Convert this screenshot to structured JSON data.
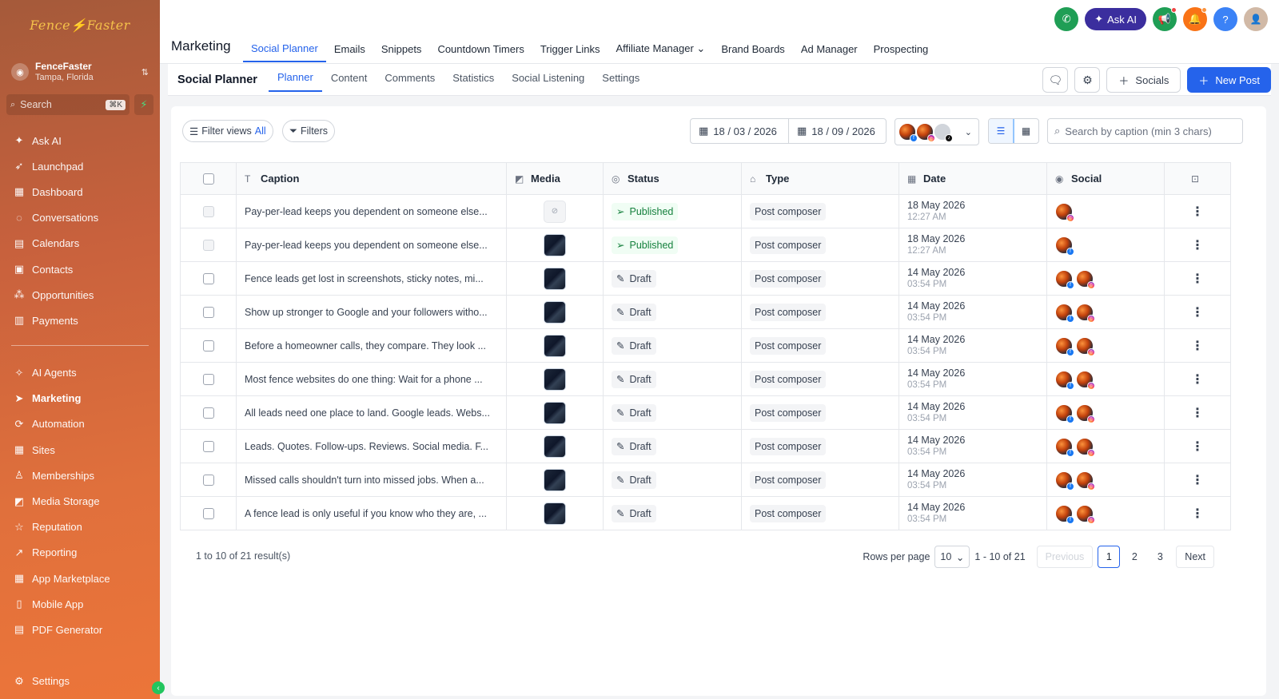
{
  "sidebar": {
    "logo_text": "Fence⚡Faster",
    "account_name": "FenceFaster",
    "account_location": "Tampa, Florida",
    "search_placeholder": "Search",
    "search_shortcut": "⌘K",
    "items_top": [
      {
        "label": "Ask AI",
        "icon": "sparkle-icon"
      },
      {
        "label": "Launchpad",
        "icon": "rocket-icon"
      },
      {
        "label": "Dashboard",
        "icon": "dashboard-icon"
      },
      {
        "label": "Conversations",
        "icon": "chat-icon"
      },
      {
        "label": "Calendars",
        "icon": "calendar-icon"
      },
      {
        "label": "Contacts",
        "icon": "contacts-icon"
      },
      {
        "label": "Opportunities",
        "icon": "opportunities-icon"
      },
      {
        "label": "Payments",
        "icon": "payments-icon"
      }
    ],
    "items_bottom": [
      {
        "label": "AI Agents",
        "icon": "ai-agents-icon"
      },
      {
        "label": "Marketing",
        "icon": "send-icon"
      },
      {
        "label": "Automation",
        "icon": "automation-icon"
      },
      {
        "label": "Sites",
        "icon": "sites-icon"
      },
      {
        "label": "Memberships",
        "icon": "memberships-icon"
      },
      {
        "label": "Media Storage",
        "icon": "media-icon"
      },
      {
        "label": "Reputation",
        "icon": "star-icon"
      },
      {
        "label": "Reporting",
        "icon": "chart-icon"
      },
      {
        "label": "App Marketplace",
        "icon": "apps-icon"
      },
      {
        "label": "Mobile App",
        "icon": "mobile-icon"
      },
      {
        "label": "PDF Generator",
        "icon": "pdf-icon"
      }
    ],
    "settings_label": "Settings"
  },
  "header": {
    "ask_ai_label": "Ask AI",
    "module_title": "Marketing",
    "tabs": [
      {
        "label": "Social Planner",
        "active": true
      },
      {
        "label": "Emails"
      },
      {
        "label": "Snippets"
      },
      {
        "label": "Countdown Timers"
      },
      {
        "label": "Trigger Links"
      },
      {
        "label": "Affiliate Manager ⌄"
      },
      {
        "label": "Brand Boards"
      },
      {
        "label": "Ad Manager"
      },
      {
        "label": "Prospecting"
      }
    ]
  },
  "subheader": {
    "title": "Social Planner",
    "tabs": [
      {
        "label": "Planner",
        "active": true
      },
      {
        "label": "Content"
      },
      {
        "label": "Comments"
      },
      {
        "label": "Statistics"
      },
      {
        "label": "Social Listening"
      },
      {
        "label": "Settings"
      }
    ],
    "socials_label": "Socials",
    "new_post_label": "New Post"
  },
  "toolbar": {
    "filter_views_label": "Filter views",
    "filter_views_value": "All",
    "filters_label": "Filters",
    "date_from": "18 / 03 / 2026",
    "date_to": "18 / 09 / 2026",
    "search_placeholder": "Search by caption (min 3 chars)"
  },
  "table": {
    "headers": {
      "caption": "Caption",
      "media": "Media",
      "status": "Status",
      "type": "Type",
      "date": "Date",
      "social": "Social"
    },
    "rows": [
      {
        "caption": "Pay-per-lead keeps you dependent on someone else...",
        "media": "placeholder",
        "status": "Published",
        "type": "Post composer",
        "date": "18 May 2026",
        "time": "12:27 AM",
        "socials": [
          [
            "ig"
          ]
        ],
        "disabled": true
      },
      {
        "caption": "Pay-per-lead keeps you dependent on someone else...",
        "media": "image",
        "status": "Published",
        "type": "Post composer",
        "date": "18 May 2026",
        "time": "12:27 AM",
        "socials": [
          [
            "fb"
          ]
        ],
        "disabled": true
      },
      {
        "caption": "Fence leads get lost in screenshots, sticky notes, mi...",
        "media": "image",
        "status": "Draft",
        "type": "Post composer",
        "date": "14 May 2026",
        "time": "03:54 PM",
        "socials": [
          [
            "fb"
          ],
          [
            "ig"
          ]
        ],
        "disabled": false
      },
      {
        "caption": "Show up stronger to Google and your followers witho...",
        "media": "image",
        "status": "Draft",
        "type": "Post composer",
        "date": "14 May 2026",
        "time": "03:54 PM",
        "socials": [
          [
            "fb"
          ],
          [
            "ig"
          ]
        ],
        "disabled": false
      },
      {
        "caption": "Before a homeowner calls, they compare. They look ...",
        "media": "image",
        "status": "Draft",
        "type": "Post composer",
        "date": "14 May 2026",
        "time": "03:54 PM",
        "socials": [
          [
            "fb"
          ],
          [
            "ig"
          ]
        ],
        "disabled": false
      },
      {
        "caption": "Most fence websites do one thing: Wait for a phone ...",
        "media": "image",
        "status": "Draft",
        "type": "Post composer",
        "date": "14 May 2026",
        "time": "03:54 PM",
        "socials": [
          [
            "fb"
          ],
          [
            "ig"
          ]
        ],
        "disabled": false
      },
      {
        "caption": "All leads need one place to land. Google leads. Webs...",
        "media": "image",
        "status": "Draft",
        "type": "Post composer",
        "date": "14 May 2026",
        "time": "03:54 PM",
        "socials": [
          [
            "fb"
          ],
          [
            "ig"
          ]
        ],
        "disabled": false
      },
      {
        "caption": "Leads. Quotes. Follow-ups. Reviews. Social media. F...",
        "media": "image",
        "status": "Draft",
        "type": "Post composer",
        "date": "14 May 2026",
        "time": "03:54 PM",
        "socials": [
          [
            "fb"
          ],
          [
            "ig"
          ]
        ],
        "disabled": false
      },
      {
        "caption": "Missed calls shouldn't turn into missed jobs. When a...",
        "media": "image",
        "status": "Draft",
        "type": "Post composer",
        "date": "14 May 2026",
        "time": "03:54 PM",
        "socials": [
          [
            "fb"
          ],
          [
            "ig"
          ]
        ],
        "disabled": false
      },
      {
        "caption": "A fence lead is only useful if you know who they are, ...",
        "media": "image",
        "status": "Draft",
        "type": "Post composer",
        "date": "14 May 2026",
        "time": "03:54 PM",
        "socials": [
          [
            "fb"
          ],
          [
            "ig"
          ]
        ],
        "disabled": false
      }
    ]
  },
  "footer": {
    "results_text": "1 to 10 of 21 result(s)",
    "rows_per_page_label": "Rows per page",
    "rows_per_page_value": "10",
    "range_text": "1 - 10 of 21",
    "previous_label": "Previous",
    "next_label": "Next",
    "pages": [
      "1",
      "2",
      "3"
    ],
    "current_page": "1"
  },
  "colors": {
    "accent": "#2563eb",
    "sidebar_start": "#a55a3a",
    "sidebar_end": "#ec7539",
    "published": "#15803d"
  }
}
